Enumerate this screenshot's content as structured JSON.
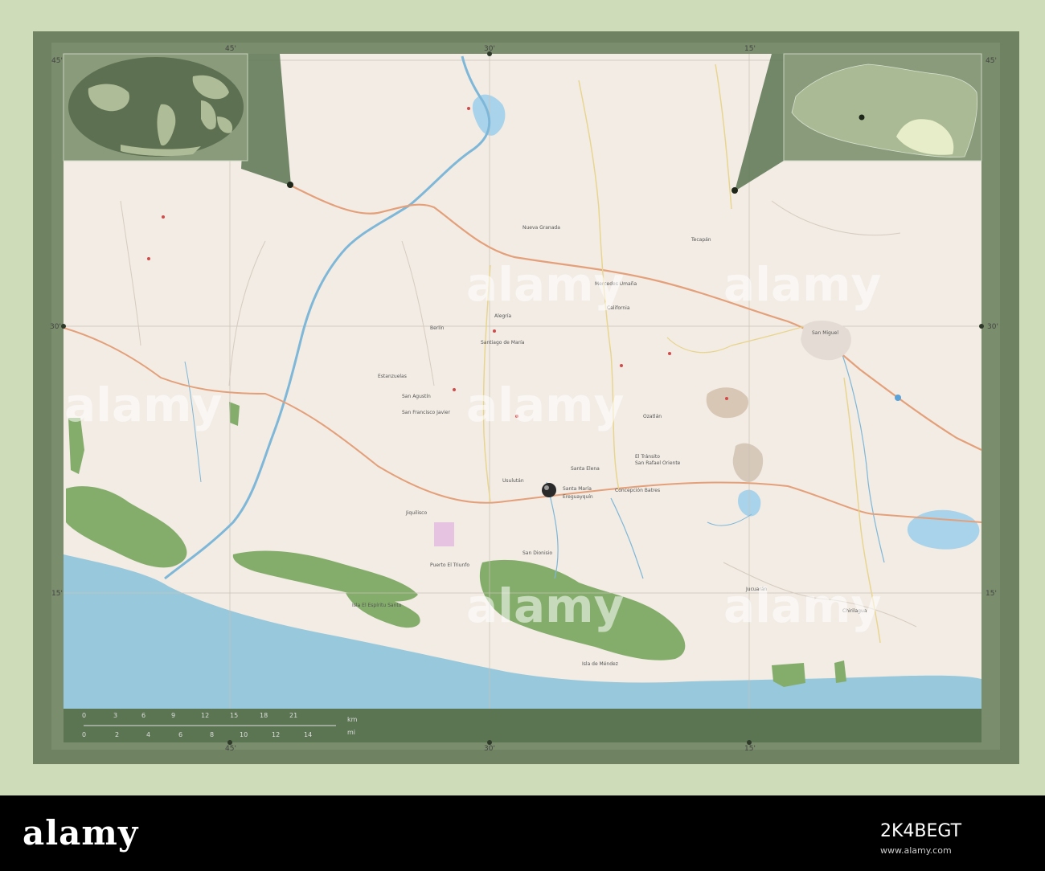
{
  "colors": {
    "outer_bg": "#cfdcba",
    "frame": "#6f8362",
    "inner_frame": "#7a8d6c",
    "land": "#f2ece4",
    "sea": "#98c8dc",
    "lake": "#a9d3ea",
    "mangrove": "#84ad6b",
    "road_primary": "#e3a07a",
    "road_secondary": "#e8d48a",
    "river": "#7eb7d8",
    "scale_band": "#5b7552"
  },
  "grid_labels": {
    "top": [
      "45'",
      "30'",
      "15'"
    ],
    "bottom": [
      "45'",
      "30'",
      "15'"
    ],
    "left": [
      "45'",
      "30'",
      "15'"
    ],
    "right": [
      "45'",
      "30'",
      "15'"
    ]
  },
  "scale_bar": {
    "km_ticks": [
      "0",
      "3",
      "6",
      "9",
      "12",
      "15",
      "18",
      "21"
    ],
    "km_unit": "km",
    "mi_ticks": [
      "0",
      "2",
      "4",
      "6",
      "8",
      "10",
      "12",
      "14"
    ],
    "mi_unit": "mi"
  },
  "inset_globe": {
    "icon": "globe-icon"
  },
  "inset_country": {
    "icon": "country-outline-icon"
  },
  "location_marker": {
    "icon": "sphere-marker-icon"
  },
  "place_labels": [
    "San Miguel",
    "Santa María",
    "Usulután",
    "Jiquilisco",
    "Jucuarán",
    "Santiago de María",
    "Berlín",
    "Alegría",
    "Mercedes Umaña",
    "San Dionisio",
    "Concepción Batres",
    "Puerto El Triunfo",
    "Isla El Espíritu Santo",
    "Isla de Méndez",
    "Chirilagua",
    "El Tránsito",
    "San Rafael Oriente",
    "Ozatlán",
    "Ereguayquín",
    "Estanzuelas",
    "Nueva Granada",
    "Tecapán",
    "California",
    "San Francisco Javier",
    "San Agustín",
    "Santa Elena"
  ],
  "watermark_text": "alamy",
  "footer": {
    "brand": "alamy",
    "stock_id": "2K4BEGT",
    "line": "www.alamy.com"
  }
}
